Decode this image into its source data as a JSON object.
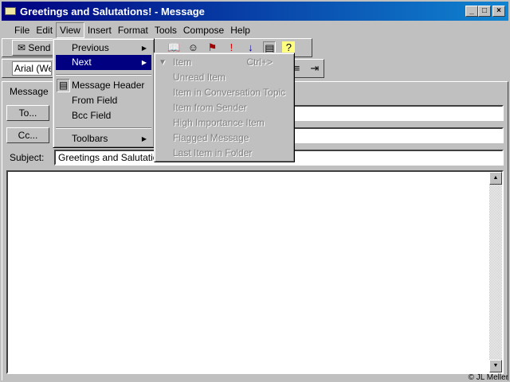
{
  "window": {
    "title": "Greetings and Salutations! - Message",
    "min": "_",
    "max": "□",
    "close": "×"
  },
  "menubar": [
    "File",
    "Edit",
    "View",
    "Insert",
    "Format",
    "Tools",
    "Compose",
    "Help"
  ],
  "toolbar": {
    "send": "Send",
    "font": "Arial (Western)"
  },
  "tab": "Message",
  "form": {
    "to": "To...",
    "cc": "Cc...",
    "subject_label": "Subject:",
    "subject": "Greetings and Salutations!",
    "to_value": "",
    "cc_value": ""
  },
  "view_menu": {
    "previous": "Previous",
    "next": "Next",
    "message_header": "Message Header",
    "from_field": "From Field",
    "bcc_field": "Bcc Field",
    "toolbars": "Toolbars"
  },
  "next_submenu": {
    "items": [
      "Item",
      "Unread Item",
      "Item in Conversation Topic",
      "Item from Sender",
      "High Importance Item",
      "Flagged Message",
      "Last Item in Folder"
    ],
    "shortcut": "Ctrl+>"
  },
  "copyright": "© JL Meller"
}
